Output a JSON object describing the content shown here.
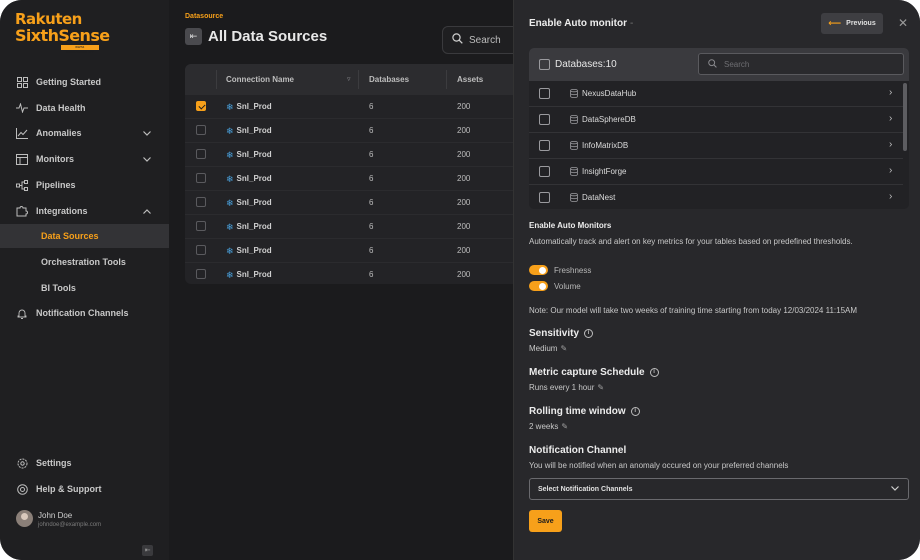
{
  "brand": {
    "line1": "Rakuten",
    "line2": "SixthSense",
    "tag": "DATA OBSERVABILITY",
    "color": "#f7a01a"
  },
  "sidebar": {
    "items": [
      {
        "label": "Getting Started",
        "icon": "grid-icon"
      },
      {
        "label": "Data Health",
        "icon": "pulse-icon"
      },
      {
        "label": "Anomalies",
        "icon": "chart-icon"
      },
      {
        "label": "Monitors",
        "icon": "monitor-icon"
      },
      {
        "label": "Pipelines",
        "icon": "pipeline-icon"
      },
      {
        "label": "Integrations",
        "icon": "puzzle-icon"
      },
      {
        "label": "Data Sources"
      },
      {
        "label": "Orchestration Tools"
      },
      {
        "label": "BI Tools"
      },
      {
        "label": "Notification Channels",
        "icon": "bell-icon"
      }
    ],
    "footer": [
      {
        "label": "Settings",
        "icon": "gear-icon"
      },
      {
        "label": "Help & Support",
        "icon": "help-icon"
      }
    ],
    "user": {
      "name": "John Doe",
      "email": "johndoe@example.com"
    }
  },
  "main": {
    "breadcrumb": "Datasource",
    "title": "All Data Sources",
    "search_label": "Search",
    "table": {
      "headers": [
        "Connection Name",
        "Databases",
        "Assets"
      ],
      "rows": [
        {
          "name": "Snl_Prod",
          "databases": "6",
          "assets": "200",
          "checked": true
        },
        {
          "name": "Snl_Prod",
          "databases": "6",
          "assets": "200",
          "checked": false
        },
        {
          "name": "Snl_Prod",
          "databases": "6",
          "assets": "200",
          "checked": false
        },
        {
          "name": "Snl_Prod",
          "databases": "6",
          "assets": "200",
          "checked": false
        },
        {
          "name": "Snl_Prod",
          "databases": "6",
          "assets": "200",
          "checked": false
        },
        {
          "name": "Snl_Prod",
          "databases": "6",
          "assets": "200",
          "checked": false
        },
        {
          "name": "Snl_Prod",
          "databases": "6",
          "assets": "200",
          "checked": false
        },
        {
          "name": "Snl_Prod",
          "databases": "6",
          "assets": "200",
          "checked": false
        }
      ]
    }
  },
  "drawer": {
    "title": "Enable Auto monitor",
    "title_dash": "-",
    "previous_label": "Previous",
    "databases_label": "Databases:10",
    "search_placeholder": "Search",
    "databases": [
      "NexusDataHub",
      "DataSphereDB",
      "InfoMatrixDB",
      "InsightForge",
      "DataNest"
    ],
    "auto_monitors": {
      "title": "Enable Auto Monitors",
      "description": "Automatically track and alert on key metrics for your tables based on predefined thresholds.",
      "toggles": [
        {
          "label": "Freshness",
          "on": true
        },
        {
          "label": "Volume",
          "on": true
        }
      ]
    },
    "note": "Note: Our model will take two weeks of training time starting from today 12/03/2024 11:15AM",
    "sensitivity": {
      "title": "Sensitivity",
      "value": "Medium"
    },
    "schedule": {
      "title": "Metric capture Schedule",
      "value": "Runs every 1 hour"
    },
    "rolling": {
      "title": "Rolling time window",
      "value": "2 weeks"
    },
    "notification": {
      "title": "Notification Channel",
      "description": "You will be notified when an anomaly occured on your preferred channels",
      "select_label": "Select Notification Channels"
    },
    "save_label": "Save"
  }
}
